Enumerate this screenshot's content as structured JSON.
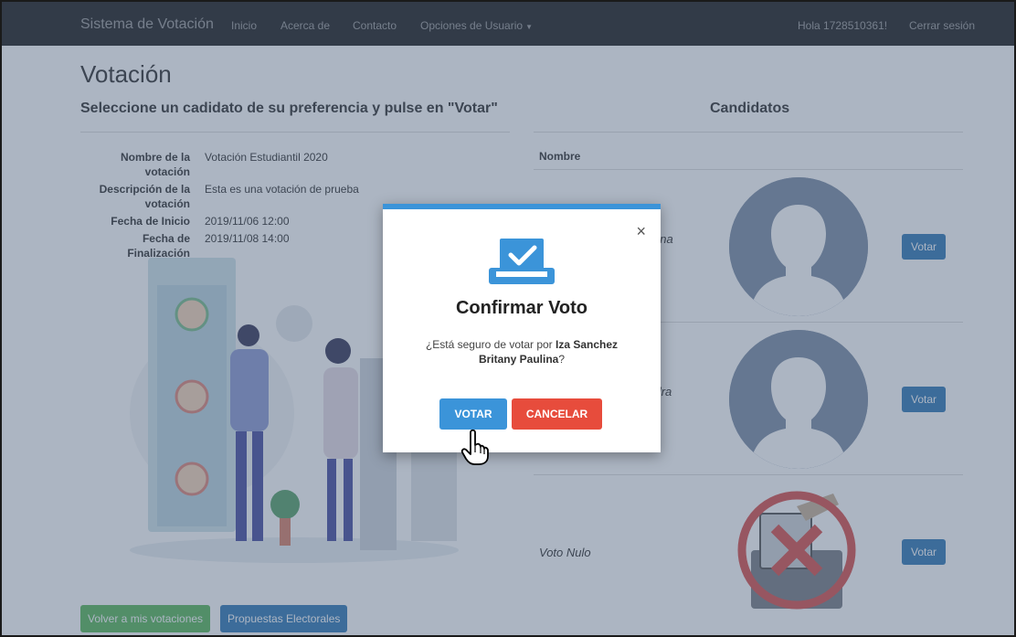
{
  "navbar": {
    "brand": "Sistema de Votación",
    "links": [
      "Inicio",
      "Acerca de",
      "Contacto",
      "Opciones de Usuario"
    ],
    "greeting": "Hola 1728510361!",
    "logout": "Cerrar sesión"
  },
  "main": {
    "title": "Votación",
    "subtitle": "Seleccione un cadidato de su preferencia y pulse en \"Votar\"",
    "details": [
      {
        "label": "Nombre de la votación",
        "value": "Votación Estudiantil 2020"
      },
      {
        "label": "Descripción de la votación",
        "value": "Esta es una votación de prueba"
      },
      {
        "label": "Fecha de Inicio",
        "value": "2019/11/06 12:00"
      },
      {
        "label": "Fecha de Finalización",
        "value": "2019/11/08 14:00"
      }
    ],
    "buttons": {
      "back": "Volver a mis votaciones",
      "proposals": "Propuestas Electorales"
    }
  },
  "candidates": {
    "title": "Candidatos",
    "column_header": "Nombre",
    "rows": [
      {
        "name_partial": "aulina",
        "vote_label": "Votar"
      },
      {
        "name_partial": "andra",
        "vote_label": "Votar"
      },
      {
        "name": "Voto Nulo",
        "vote_label": "Votar"
      }
    ]
  },
  "modal": {
    "title": "Confirmar Voto",
    "text_prefix": "¿Está seguro de votar por ",
    "candidate": "Iza Sanchez Britany Paulina",
    "text_suffix": "?",
    "confirm": "VOTAR",
    "cancel": "CANCELAR",
    "close": "×"
  },
  "colors": {
    "primary": "#337ab7",
    "confirm": "#3b94d9",
    "cancel": "#e74c3c",
    "success": "#5cb85c",
    "navbar": "#222222"
  }
}
